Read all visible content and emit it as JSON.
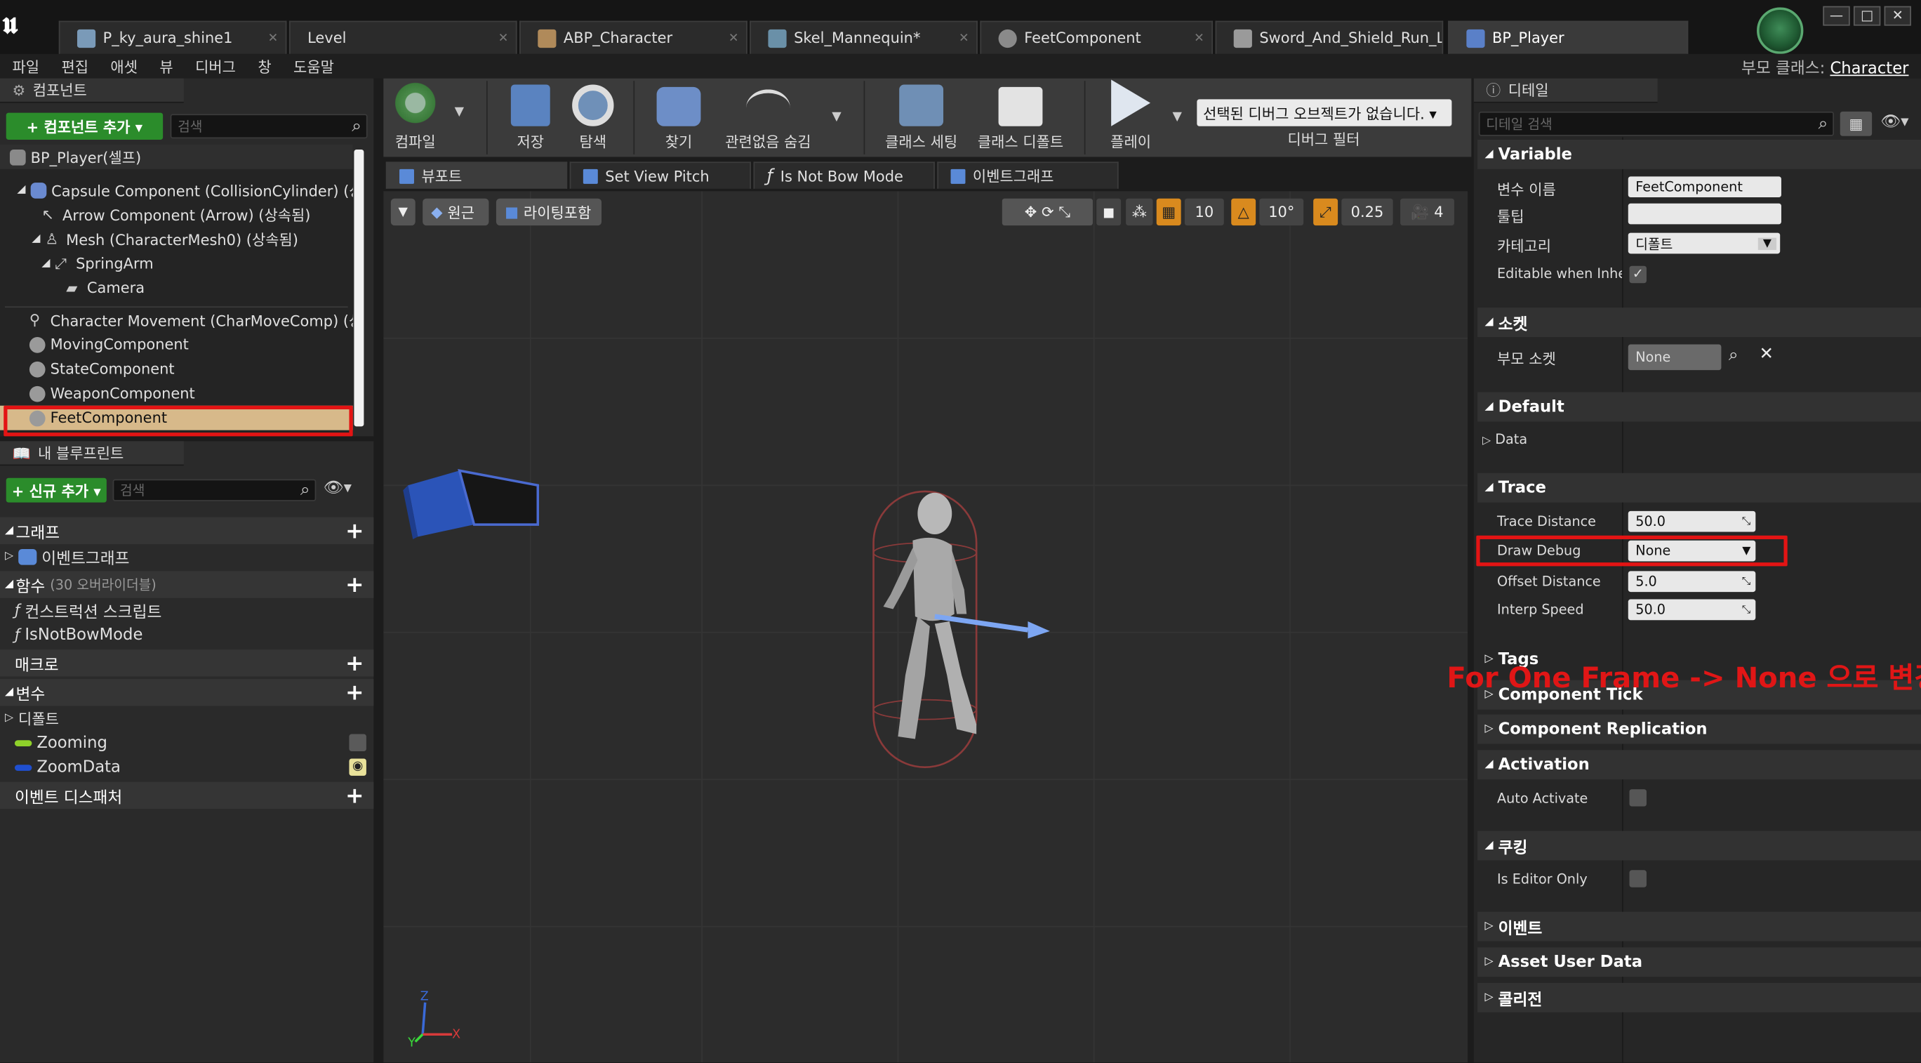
{
  "tabs": [
    "P_ky_aura_shine1",
    "Level",
    "ABP_Character",
    "Skel_Mannequin*",
    "FeetComponent",
    "Sword_And_Shield_Run_L",
    "BP_Player"
  ],
  "window_buttons": [
    "—",
    "□",
    "✕"
  ],
  "menu": [
    "파일",
    "편집",
    "애셋",
    "뷰",
    "디버그",
    "창",
    "도움말"
  ],
  "parent_class": {
    "label": "부모 클래스:",
    "value": "Character"
  },
  "components": {
    "tab": "컴포넌트",
    "add_button": "+ 컴포넌트 추가 ▾",
    "search_placeholder": "검색",
    "root": "BP_Player(셀프)",
    "tree": [
      "Capsule Component (CollisionCylinder) (상속됨)",
      "Arrow Component (Arrow) (상속됨)",
      "Mesh (CharacterMesh0) (상속됨)",
      "SpringArm",
      "Camera",
      "Character Movement (CharMoveComp) (상속됨)",
      "MovingComponent",
      "StateComponent",
      "WeaponComponent",
      "FeetComponent"
    ]
  },
  "my_blueprint": {
    "tab": "내 블루프린트",
    "add_button": "+ 신규 추가 ▾",
    "search_placeholder": "검색",
    "graph_header": "그래프",
    "event_graph": "이벤트그래프",
    "functions_header": "함수",
    "functions_sub": "(30 오버라이더블)",
    "functions": [
      "컨스트럭션 스크립트",
      "IsNotBowMode"
    ],
    "macro_header": "매크로",
    "variables_header": "변수",
    "default_group": "디폴트",
    "variables": [
      "Zooming",
      "ZoomData"
    ],
    "dispatcher_header": "이벤트 디스패처"
  },
  "toolbar": {
    "items": [
      "컴파일",
      "저장",
      "탐색",
      "찾기",
      "관련없음 숨김",
      "클래스 세팅",
      "클래스 디폴트",
      "플레이"
    ],
    "debug_dropdown": "선택된 디버그 오브젝트가 없습니다. ▾",
    "debug_filter": "디버그 필터"
  },
  "view_tabs": [
    "뷰포트",
    "Set View Pitch",
    "Is Not Bow Mode",
    "이벤트그래프"
  ],
  "viewport": {
    "perspective": "원근",
    "lit": "라이팅포함",
    "grid_snap": "10",
    "rot_snap": "10°",
    "scale_snap": "0.25",
    "cam_speed": "4"
  },
  "details": {
    "tab": "디테일",
    "search_placeholder": "디테일 검색",
    "variable": {
      "header": "Variable",
      "var_name_label": "변수 이름",
      "var_name_value": "FeetComponent",
      "tooltip_label": "툴팁",
      "tooltip_value": "",
      "category_label": "카테고리",
      "category_value": "디폴트",
      "editable_label": "Editable when Inherited"
    },
    "socket": {
      "header": "소켓",
      "parent_socket_label": "부모 소켓",
      "parent_socket_value": "None"
    },
    "default": {
      "header": "Default",
      "data_label": "Data"
    },
    "trace": {
      "header": "Trace",
      "trace_distance_label": "Trace Distance",
      "trace_distance_value": "50.0",
      "draw_debug_label": "Draw Debug",
      "draw_debug_value": "None",
      "offset_distance_label": "Offset Distance",
      "offset_distance_value": "5.0",
      "interp_speed_label": "Interp Speed",
      "interp_speed_value": "50.0"
    },
    "tags": "Tags",
    "component_tick": "Component Tick",
    "component_replication": "Component Replication",
    "activation": {
      "header": "Activation",
      "auto_activate_label": "Auto Activate"
    },
    "cooking": {
      "header": "쿠킹",
      "editor_only_label": "Is Editor Only"
    },
    "events": "이벤트",
    "asset_user_data": "Asset User Data",
    "collision": "콜리전"
  },
  "annotation": "For One Frame -> None 으로 변경",
  "colors": {
    "highlight_red": "#e31414",
    "selected_row": "#d7b98a",
    "add_green": "#2b8c2b"
  }
}
